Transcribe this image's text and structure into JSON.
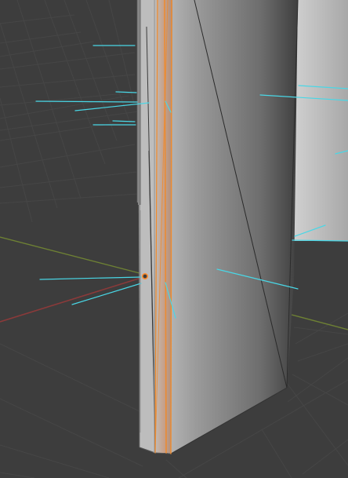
{
  "viewport": {
    "background_color": "#3d3d3d",
    "grid_color": "#484848",
    "x_axis_color": "#8a3a3a",
    "y_axis_color": "#6b7f35",
    "mesh": {
      "face_color_light": "#c8c8c8",
      "face_color_mid": "#9c9c9c",
      "face_color_dark": "#5b5b5b",
      "edge_color": "#1b1b1b",
      "selected_edge_color": "#f08a2a",
      "normal_line_color": "#49d7e6",
      "origin_color": "#ff8a2a"
    }
  }
}
